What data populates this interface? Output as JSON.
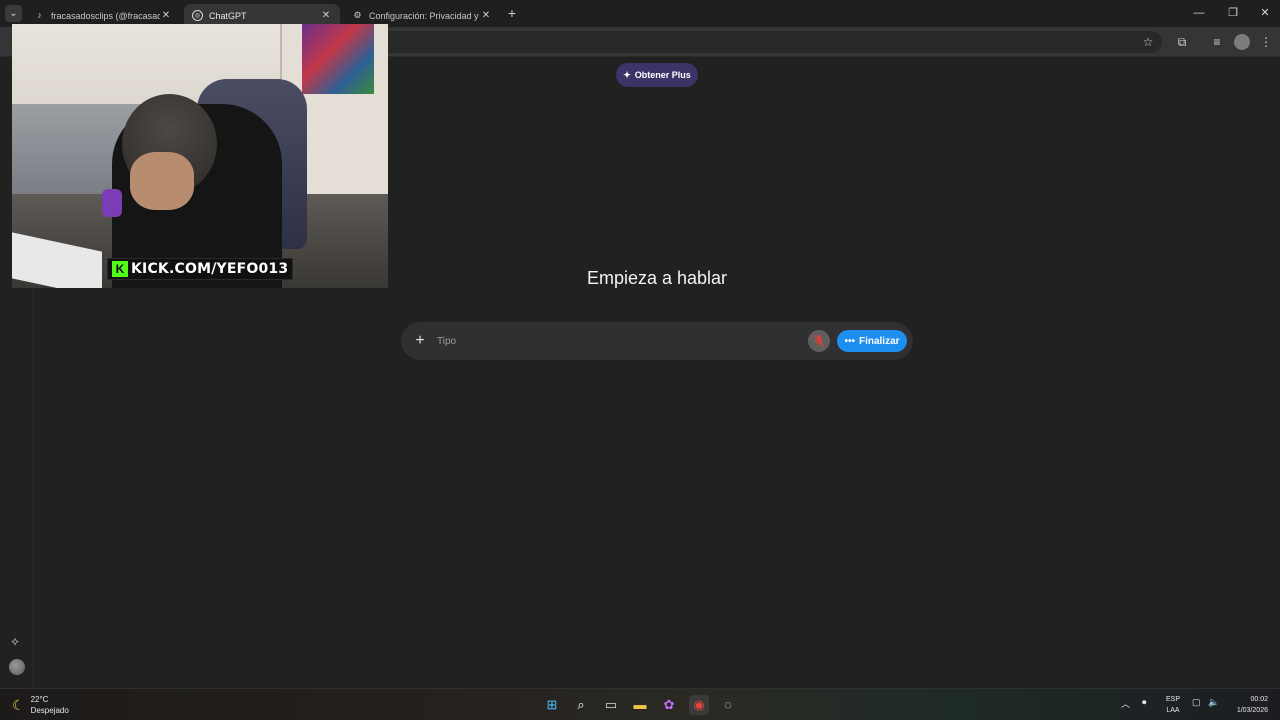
{
  "browser": {
    "tabs": [
      {
        "title": "fracasadosclips (@fracasadosclips",
        "favicon": "tiktok-icon",
        "active": false
      },
      {
        "title": "ChatGPT",
        "favicon": "chatgpt-icon",
        "active": true
      },
      {
        "title": "Configuración: Privacidad y seg",
        "favicon": "gear-icon",
        "active": false
      }
    ],
    "close_glyph": "✕",
    "new_tab_glyph": "+",
    "window_controls": {
      "minimize": "—",
      "restore": "❐",
      "close": "✕"
    }
  },
  "page": {
    "plus_button": "Obtener Plus",
    "headline": "Empieza a hablar",
    "composer": {
      "placeholder": "Tipo",
      "end_button": "Finalizar"
    }
  },
  "overlay": {
    "badge_text": "KICK.COM/YEFO013",
    "badge_logo": "K"
  },
  "taskbar": {
    "weather": {
      "temp": "22°C",
      "condition": "Despejado"
    },
    "language": {
      "line1": "ESP",
      "line2": "LAA"
    },
    "clock": {
      "time": "00:02",
      "date": "1/03/2026"
    }
  },
  "colors": {
    "background": "#212121",
    "plus_button_bg": "#3b3466",
    "end_button_bg": "#1f8ef1",
    "kick_green": "#53fc18"
  }
}
